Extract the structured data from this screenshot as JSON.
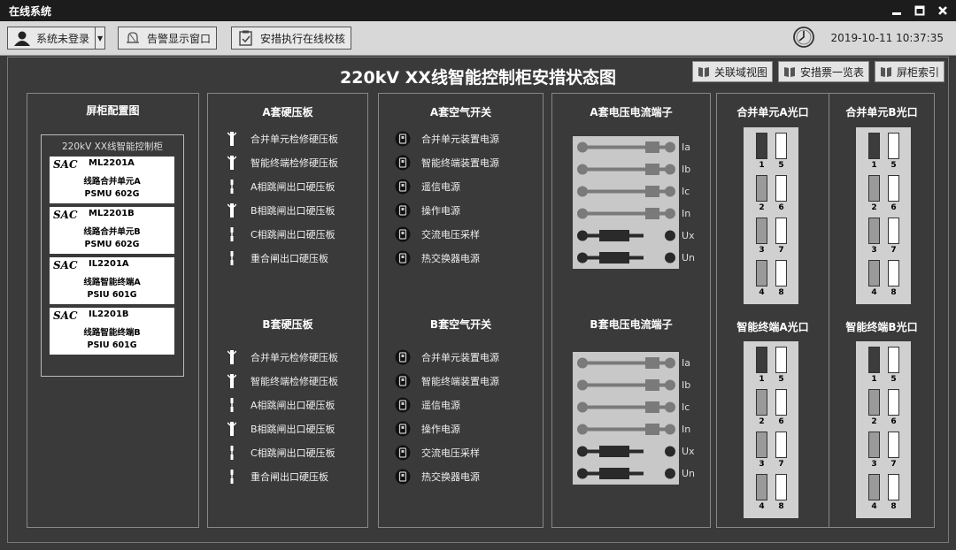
{
  "window": {
    "title": "在线系统"
  },
  "toolbar": {
    "user_label": "系统未登录",
    "alarm_label": "告警显示窗口",
    "check_label": "安措执行在线校核",
    "datetime": "2019-10-11 10:37:35"
  },
  "page": {
    "title": "220kV XX线智能控制柜安措状态图"
  },
  "topnav": {
    "assoc": "关联域视图",
    "ticket": "安措票一览表",
    "cabinet": "屏柜索引"
  },
  "cabinet": {
    "header": "屏柜配置图",
    "name": "220kV XX线智能控制柜",
    "devices": [
      {
        "logo": "SAC",
        "model": "ML2201A",
        "line1": "线路合并单元A",
        "line2": "PSMU 602G"
      },
      {
        "logo": "SAC",
        "model": "ML2201B",
        "line1": "线路合并单元B",
        "line2": "PSMU 602G"
      },
      {
        "logo": "SAC",
        "model": "IL2201A",
        "line1": "线路智能终端A",
        "line2": "PSIU 601G"
      },
      {
        "logo": "SAC",
        "model": "IL2201B",
        "line1": "线路智能终端B",
        "line2": "PSIU 601G"
      }
    ]
  },
  "hard_a": {
    "header": "A套硬压板",
    "items": [
      "合并单元检修硬压板",
      "智能终端检修硬压板",
      "A相跳闸出口硬压板",
      "B相跳闸出口硬压板",
      "C相跳闸出口硬压板",
      "重合闸出口硬压板"
    ],
    "states": [
      "on",
      "on",
      "off",
      "on",
      "off",
      "off"
    ]
  },
  "hard_b": {
    "header": "B套硬压板",
    "items": [
      "合并单元检修硬压板",
      "智能终端检修硬压板",
      "A相跳闸出口硬压板",
      "B相跳闸出口硬压板",
      "C相跳闸出口硬压板",
      "重合闸出口硬压板"
    ],
    "states": [
      "on",
      "on",
      "off",
      "on",
      "off",
      "off"
    ]
  },
  "air_a": {
    "header": "A套空气开关",
    "items": [
      "合并单元装置电源",
      "智能终端装置电源",
      "遥信电源",
      "操作电源",
      "交流电压采样",
      "热交换器电源"
    ]
  },
  "air_b": {
    "header": "B套空气开关",
    "items": [
      "合并单元装置电源",
      "智能终端装置电源",
      "遥信电源",
      "操作电源",
      "交流电压采样",
      "热交换器电源"
    ]
  },
  "term_a": {
    "header": "A套电压电流端子",
    "labels": [
      "Ia",
      "Ib",
      "Ic",
      "In",
      "Ux",
      "Un"
    ],
    "states": [
      "closed",
      "closed",
      "closed",
      "closed",
      "open",
      "open"
    ]
  },
  "term_b": {
    "header": "B套电压电流端子",
    "labels": [
      "Ia",
      "Ib",
      "Ic",
      "In",
      "Ux",
      "Un"
    ],
    "states": [
      "closed",
      "closed",
      "closed",
      "closed",
      "open",
      "open"
    ]
  },
  "optical": {
    "mu_a": "合并单元A光口",
    "mu_b": "合并单元B光口",
    "it_a": "智能终端A光口",
    "it_b": "智能终端B光口",
    "port_numbers": [
      "1",
      "2",
      "3",
      "4",
      "5",
      "6",
      "7",
      "8"
    ],
    "mu_left_states": [
      "dark",
      "gray",
      "gray",
      "gray"
    ],
    "it_left_states": [
      "dark",
      "gray",
      "gray",
      "gray"
    ]
  },
  "colors": {
    "bg": "#3a3a3a",
    "terminal": "#c8c8c8",
    "port_dark": "#3c3c3c",
    "port_gray": "#9a9a9a"
  }
}
